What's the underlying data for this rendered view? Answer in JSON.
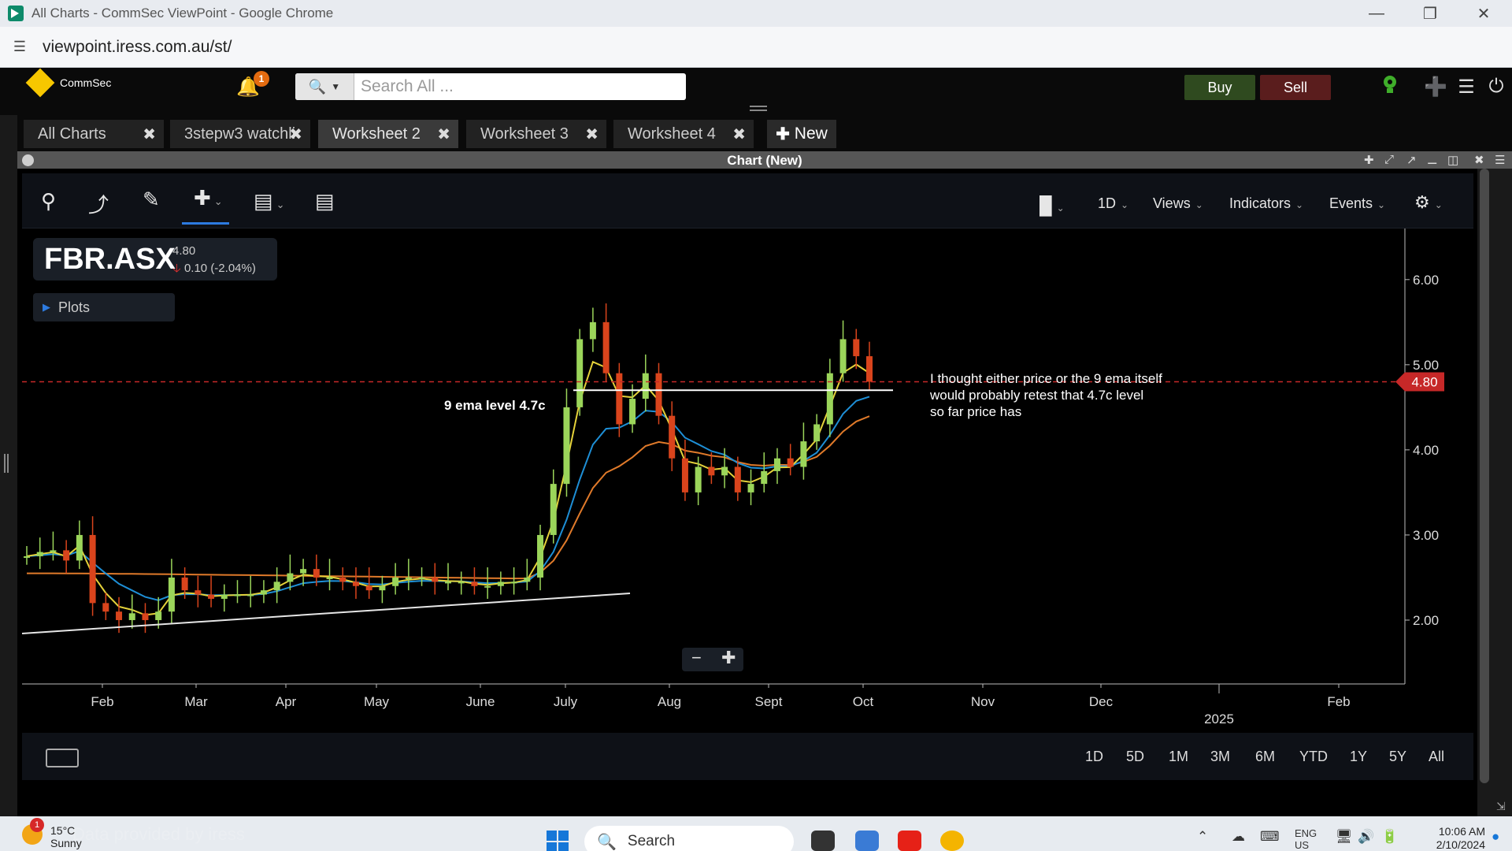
{
  "window": {
    "title": "All Charts - CommSec ViewPoint - Google Chrome",
    "url": "viewpoint.iress.com.au/st/"
  },
  "header": {
    "brand": "CommSec",
    "notifications_count": "1",
    "search_placeholder": "Search All ...",
    "buy_label": "Buy",
    "sell_label": "Sell"
  },
  "tabs": [
    {
      "label": "All Charts",
      "active": false
    },
    {
      "label": "3stepw3 watchli",
      "active": false
    },
    {
      "label": "Worksheet 2",
      "active": true
    },
    {
      "label": "Worksheet 3",
      "active": false
    },
    {
      "label": "Worksheet 4",
      "active": false
    }
  ],
  "new_tab_label": "New",
  "chart_window": {
    "title": "Chart (New)",
    "interval": "1D",
    "views_label": "Views",
    "indicators_label": "Indicators",
    "events_label": "Events"
  },
  "symbol": {
    "ticker": "FBR.ASX",
    "price": "4.80",
    "change": "0.10 (-2.04%)"
  },
  "plots_label": "Plots",
  "annotations": {
    "ema_label": "9 ema level 4.7c",
    "note_lines": [
      "I thought either price or the 9 ema itself",
      "would probably retest that 4.7c level",
      "so far price has"
    ]
  },
  "chart_data": {
    "type": "candlestick",
    "x_tick_labels": [
      "Feb",
      "Mar",
      "Apr",
      "May",
      "June",
      "July",
      "Aug",
      "Sept",
      "Oct",
      "Nov",
      "Dec",
      "Feb"
    ],
    "year_label": "2025",
    "y_tick_labels": [
      "6.00",
      "5.00",
      "4.00",
      "3.00",
      "2.00"
    ],
    "ylim": [
      1.25,
      6.6
    ],
    "last_price": 4.8,
    "last_price_label": "4.80",
    "ema_level": 4.7,
    "colors": {
      "up": "#9bd55a",
      "down": "#d9441c",
      "ema_fast": "#e5d23a",
      "ema_mid": "#1e8fd6",
      "ema_slow": "#e07a2a",
      "last_price_line": "#c62828"
    },
    "series": [
      {
        "name": "close",
        "values": [
          2.75,
          2.8,
          2.82,
          2.7,
          3.0,
          2.2,
          2.1,
          2.0,
          2.08,
          2.0,
          2.1,
          2.5,
          2.35,
          2.3,
          2.25,
          2.3,
          2.3,
          2.3,
          2.35,
          2.45,
          2.55,
          2.6,
          2.5,
          2.5,
          2.45,
          2.4,
          2.35,
          2.4,
          2.5,
          2.5,
          2.5,
          2.45,
          2.45,
          2.45,
          2.4,
          2.4,
          2.45,
          2.45,
          2.5,
          3.0,
          3.6,
          4.5,
          5.3,
          5.5,
          4.9,
          4.3,
          4.6,
          4.9,
          4.4,
          3.9,
          3.5,
          3.8,
          3.7,
          3.8,
          3.5,
          3.6,
          3.75,
          3.9,
          3.8,
          4.1,
          4.3,
          4.9,
          5.3,
          5.1,
          4.8
        ]
      }
    ]
  },
  "range_buttons": [
    "1D",
    "5D",
    "1M",
    "3M",
    "6M",
    "YTD",
    "1Y",
    "5Y",
    "All"
  ],
  "taskbar": {
    "temperature": "15°C",
    "weather": "Sunny",
    "weather_badge": "1",
    "watermark": "Data provided by iress",
    "search_label": "Search",
    "lang": "ENG",
    "region": "US",
    "time": "10:06 AM",
    "date": "2/10/2024"
  }
}
